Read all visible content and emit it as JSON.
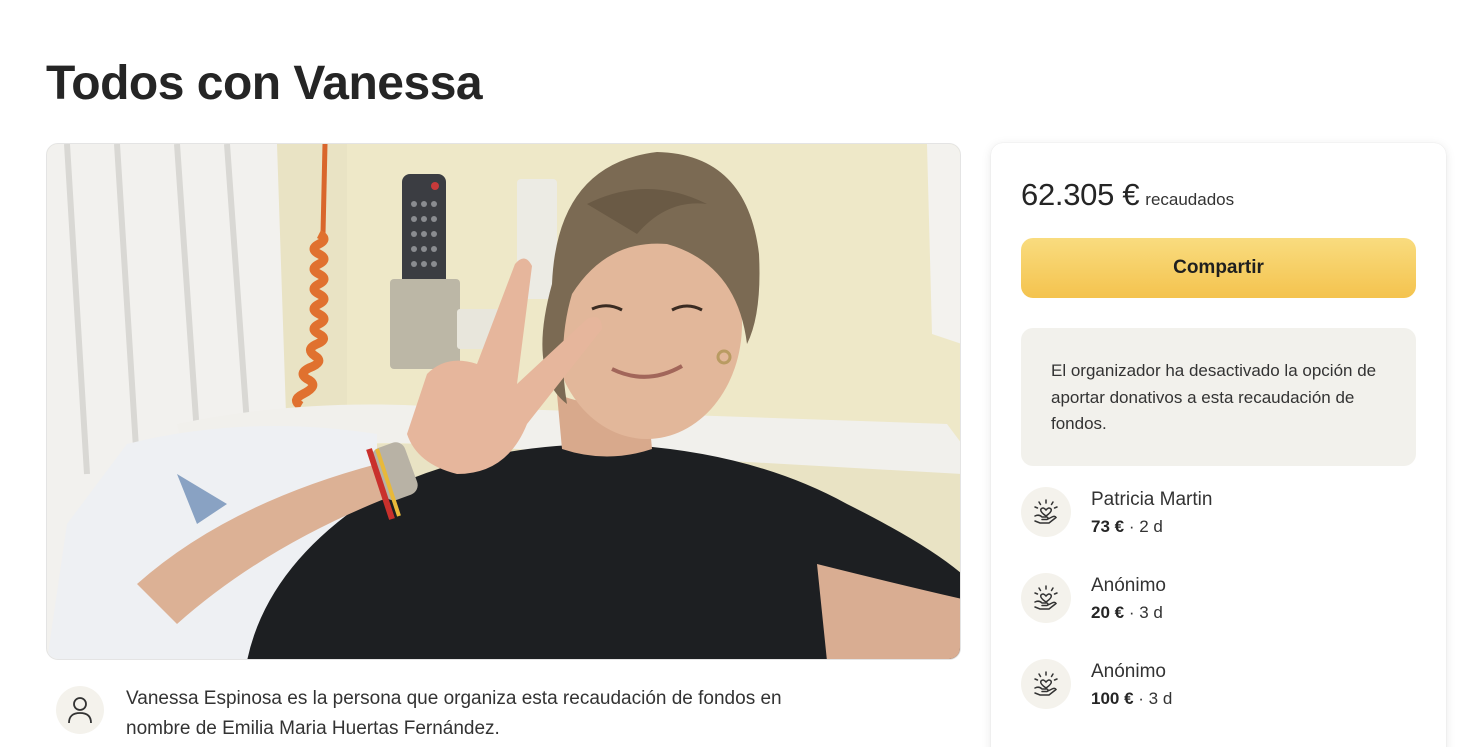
{
  "campaign": {
    "title": "Todos con Vanessa"
  },
  "organizer": {
    "description": "Vanessa Espinosa es la persona que organiza esta recaudación de fondos en nombre de Emilia Maria Huertas Fernández.",
    "icon": "user-icon"
  },
  "sidebar": {
    "raised_amount": "62.305 €",
    "raised_label": "recaudados",
    "share_label": "Compartir",
    "notice": "El organizador ha desactivado la opción de aportar donativos a esta recaudación de fondos.",
    "donation_icon": "heart-hand-icon",
    "accent_color": "#f4c34e",
    "donations": [
      {
        "name": "Patricia Martin",
        "amount": "73 €",
        "time": "2 d"
      },
      {
        "name": "Anónimo",
        "amount": "20 €",
        "time": "3 d"
      },
      {
        "name": "Anónimo",
        "amount": "100 €",
        "time": "3 d"
      }
    ]
  }
}
